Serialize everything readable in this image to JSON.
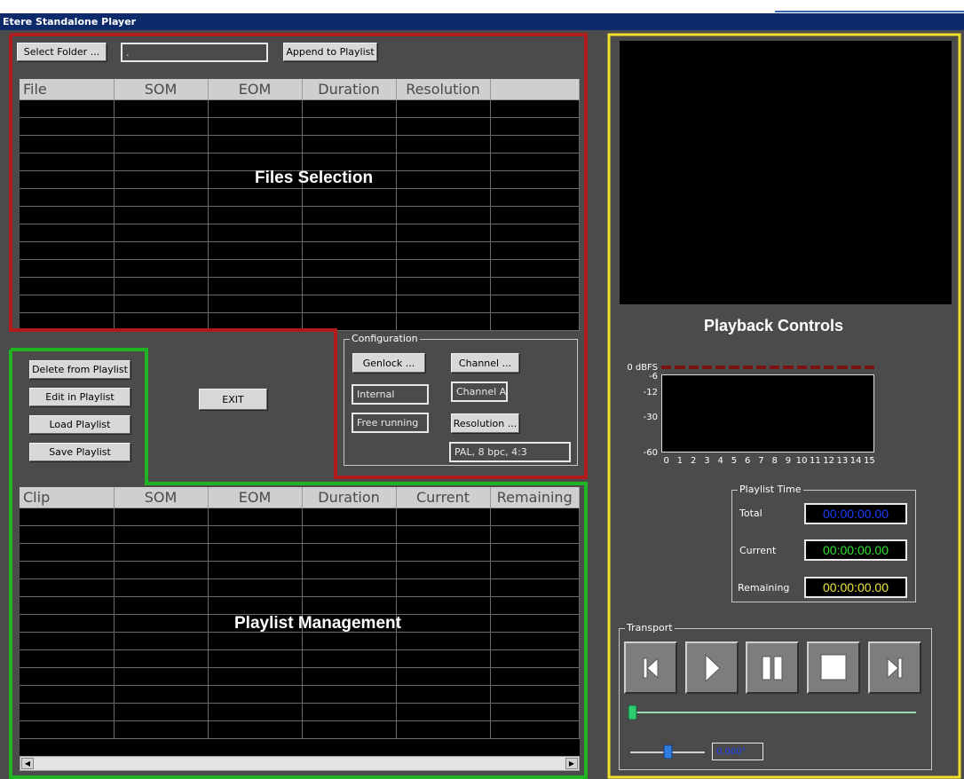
{
  "window": {
    "title": "Etere Standalone Player"
  },
  "files": {
    "select_folder_label": "Select Folder ...",
    "folder_value": ".",
    "append_label": "Append to Playlist",
    "columns": [
      "File",
      "SOM",
      "EOM",
      "Duration",
      "Resolution",
      ""
    ],
    "row_count": 13,
    "section_label": "Files Selection"
  },
  "playlist_buttons": {
    "delete_label": "Delete from Playlist",
    "edit_label": "Edit in Playlist",
    "load_label": "Load Playlist",
    "save_label": "Save Playlist",
    "exit_label": "EXIT"
  },
  "configuration": {
    "legend": "Configuration",
    "genlock_label": "Genlock ...",
    "channel_label": "Channel ...",
    "genlock_value": "Internal",
    "channel_value": "Channel A",
    "timing_value": "Free running",
    "resolution_label": "Resolution ...",
    "resolution_value": "PAL, 8 bpc, 4:3"
  },
  "playlist": {
    "columns": [
      "Clip",
      "SOM",
      "EOM",
      "Duration",
      "Current",
      "Remaining"
    ],
    "row_count": 13,
    "section_label": "Playlist Management"
  },
  "playback": {
    "section_label": "Playback Controls",
    "db_labels": [
      "0 dBFS",
      "-6",
      "-12",
      "-30",
      "-60"
    ],
    "channels": [
      "0",
      "1",
      "2",
      "3",
      "4",
      "5",
      "6",
      "7",
      "8",
      "9",
      "10",
      "11",
      "12",
      "13",
      "14",
      "15"
    ],
    "playlist_time": {
      "legend": "Playlist Time",
      "total_label": "Total",
      "total_value": "00:00:00.00",
      "current_label": "Current",
      "current_value": "00:00:00.00",
      "remaining_label": "Remaining",
      "remaining_value": "00:00:00.00"
    },
    "transport": {
      "legend": "Transport",
      "position_fraction": 0.0,
      "volume_fraction": 0.5,
      "volume_readout": "0.000\""
    }
  },
  "colors": {
    "files_frame": "#b01c1c",
    "playlist_frame": "#22b322",
    "playback_frame": "#f0e02a",
    "total_time": "#1a3cff",
    "current_time": "#2ee62e",
    "remaining_time": "#f0e63c"
  }
}
